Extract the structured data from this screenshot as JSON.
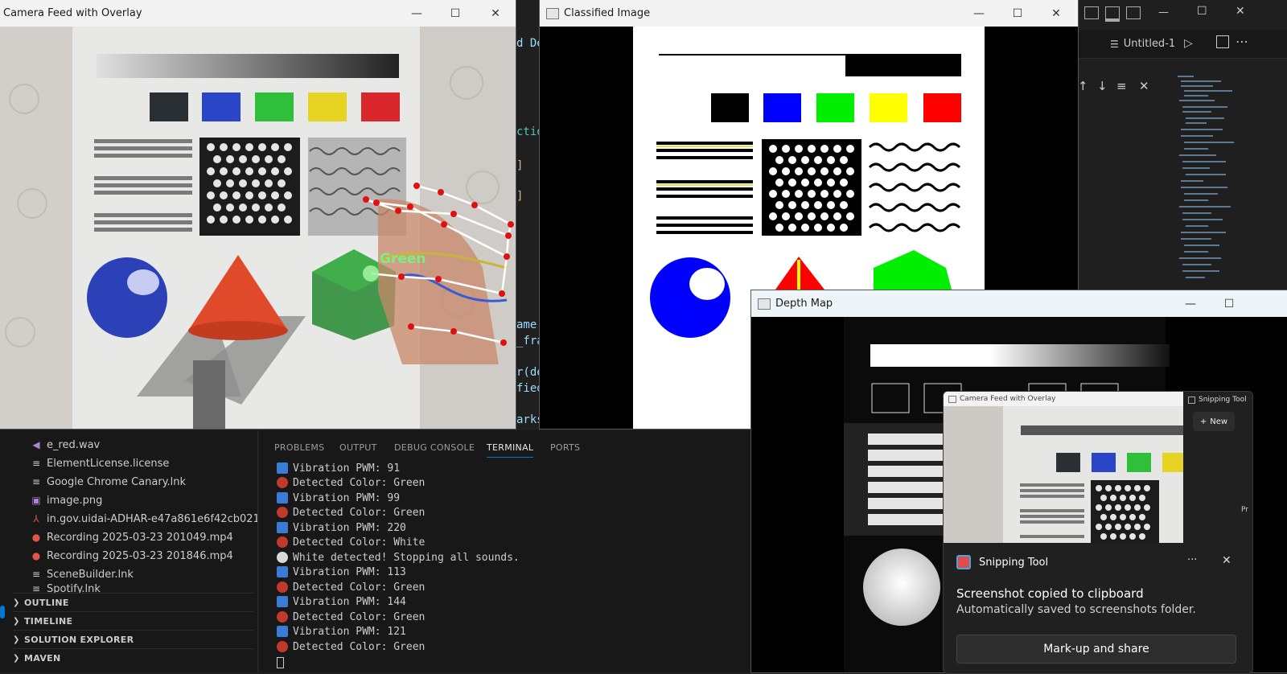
{
  "vscode": {
    "title": "Untitled-1",
    "code_fragments": [
      "d Des",
      "ctio",
      "]",
      "]",
      "ame,",
      "_fra",
      "r(de",
      "fied",
      "arks"
    ],
    "explorer_files": [
      {
        "icon": "audio-icon",
        "name": "e_red.wav"
      },
      {
        "icon": "file-icon",
        "name": "ElementLicense.license"
      },
      {
        "icon": "file-icon",
        "name": "Google Chrome Canary.lnk"
      },
      {
        "icon": "image-icon",
        "name": "image.png"
      },
      {
        "icon": "pdf-icon",
        "name": "in.gov.uidai-ADHAR-e47a861e6f42cb021..."
      },
      {
        "icon": "video-icon",
        "name": "Recording 2025-03-23 201049.mp4"
      },
      {
        "icon": "video-icon",
        "name": "Recording 2025-03-23 201846.mp4"
      },
      {
        "icon": "file-icon",
        "name": "SceneBuilder.lnk"
      },
      {
        "icon": "file-icon",
        "name": "Spotify.lnk"
      }
    ],
    "sections": [
      "OUTLINE",
      "TIMELINE",
      "SOLUTION EXPLORER",
      "MAVEN"
    ],
    "panel_tabs": [
      "PROBLEMS",
      "OUTPUT",
      "DEBUG CONSOLE",
      "TERMINAL",
      "PORTS"
    ],
    "active_tab": "TERMINAL",
    "terminal_lines": [
      {
        "icon": "vibration-icon",
        "text": "Vibration PWM: 91"
      },
      {
        "icon": "palette-icon",
        "text": "Detected Color: Green"
      },
      {
        "icon": "vibration-icon",
        "text": "Vibration PWM: 99"
      },
      {
        "icon": "palette-icon",
        "text": "Detected Color: Green"
      },
      {
        "icon": "vibration-icon",
        "text": "Vibration PWM: 220"
      },
      {
        "icon": "palette-icon",
        "text": "Detected Color: White"
      },
      {
        "icon": "mute-icon",
        "text": "White detected! Stopping all sounds."
      },
      {
        "icon": "vibration-icon",
        "text": "Vibration PWM: 113"
      },
      {
        "icon": "palette-icon",
        "text": "Detected Color: Green"
      },
      {
        "icon": "vibration-icon",
        "text": "Vibration PWM: 144"
      },
      {
        "icon": "palette-icon",
        "text": "Detected Color: Green"
      },
      {
        "icon": "vibration-icon",
        "text": "Vibration PWM: 121"
      },
      {
        "icon": "palette-icon",
        "text": "Detected Color: Green"
      }
    ]
  },
  "windows": {
    "camera": {
      "title": "Camera Feed with Overlay",
      "overlay_label": "Green"
    },
    "classified": {
      "title": "Classified Image"
    },
    "depth": {
      "title": "Depth Map"
    }
  },
  "snipping_tool": {
    "preview_title": "Camera Feed with Overlay",
    "side_title": "Snipping Tool",
    "new_label": "New",
    "side_partial": "Pr",
    "app_name": "Snipping Tool",
    "message_title": "Screenshot copied to clipboard",
    "message_body": "Automatically saved to screenshots folder.",
    "button_label": "Mark-up and share",
    "more_glyph": "···",
    "close_glyph": "✕"
  },
  "controls": {
    "minimize": "—",
    "maximize": "☐",
    "close": "✕"
  },
  "colors": {
    "green": "#22dd22",
    "blue": "#0000ff",
    "yellow": "#ffff00",
    "red": "#ff0000",
    "accent": "#0078d4"
  }
}
